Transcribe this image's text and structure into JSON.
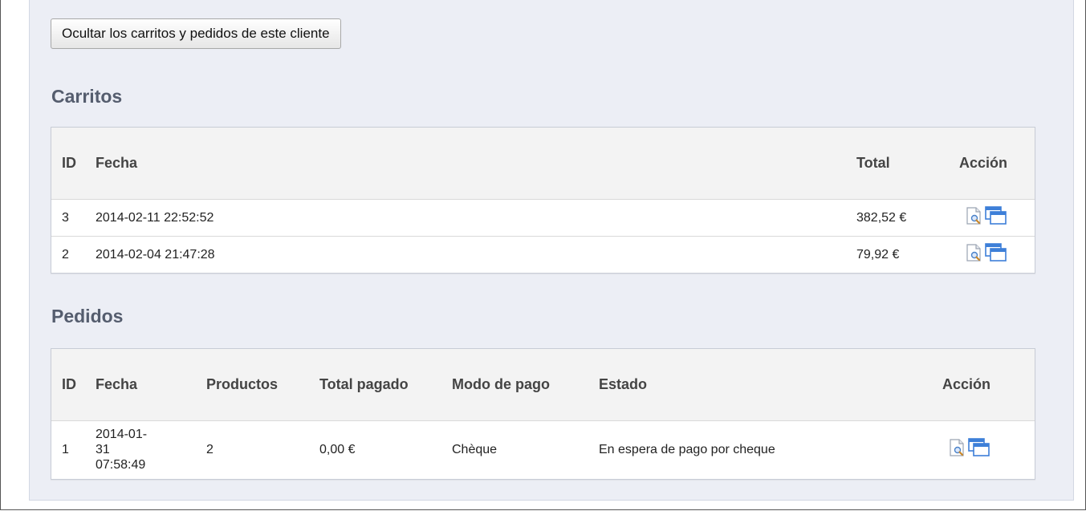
{
  "toggle_button": "Ocultar los carritos y pedidos de este cliente",
  "carts": {
    "title": "Carritos",
    "headers": {
      "id": "ID",
      "date": "Fecha",
      "total": "Total",
      "action": "Acción"
    },
    "rows": [
      {
        "id": "3",
        "date": "2014-02-11 22:52:52",
        "total": "382,52 €",
        "actions": [
          "view-icon",
          "window-icon"
        ]
      },
      {
        "id": "2",
        "date": "2014-02-04 21:47:28",
        "total": "79,92 €",
        "actions": [
          "view-icon",
          "window-icon"
        ]
      }
    ]
  },
  "orders": {
    "title": "Pedidos",
    "headers": {
      "id": "ID",
      "date": "Fecha",
      "products": "Productos",
      "total_paid": "Total pagado",
      "payment": "Modo de pago",
      "status": "Estado",
      "action": "Acción"
    },
    "rows": [
      {
        "id": "1",
        "date": "2014-01-31 07:58:49",
        "products": "2",
        "total_paid": "0,00 €",
        "payment": "Chèque",
        "status": "En espera de pago por cheque",
        "actions": [
          "view-icon",
          "window-icon"
        ]
      }
    ]
  },
  "colors": {
    "panel_bg": "#eceef5",
    "title": "#555d6e",
    "icon_blue": "#3d7fd8"
  }
}
